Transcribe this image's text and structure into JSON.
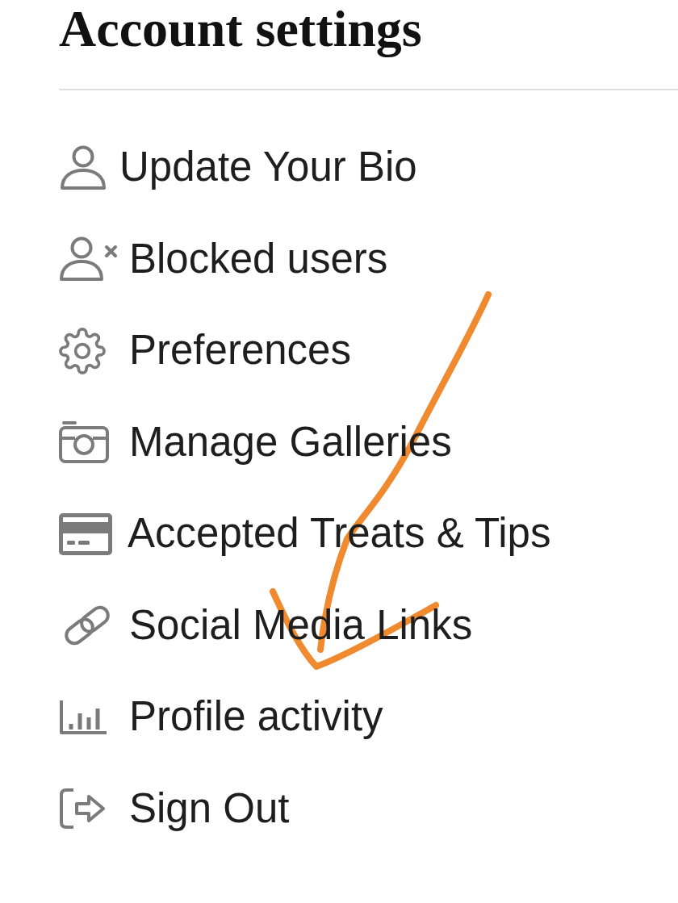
{
  "header": {
    "title": "Account settings"
  },
  "menu_items": [
    {
      "label": "Update Your Bio"
    },
    {
      "label": "Blocked users"
    },
    {
      "label": "Preferences"
    },
    {
      "label": "Manage Galleries"
    },
    {
      "label": "Accepted Treats & Tips"
    },
    {
      "label": "Social Media Links"
    },
    {
      "label": "Profile activity"
    },
    {
      "label": "Sign Out"
    }
  ]
}
